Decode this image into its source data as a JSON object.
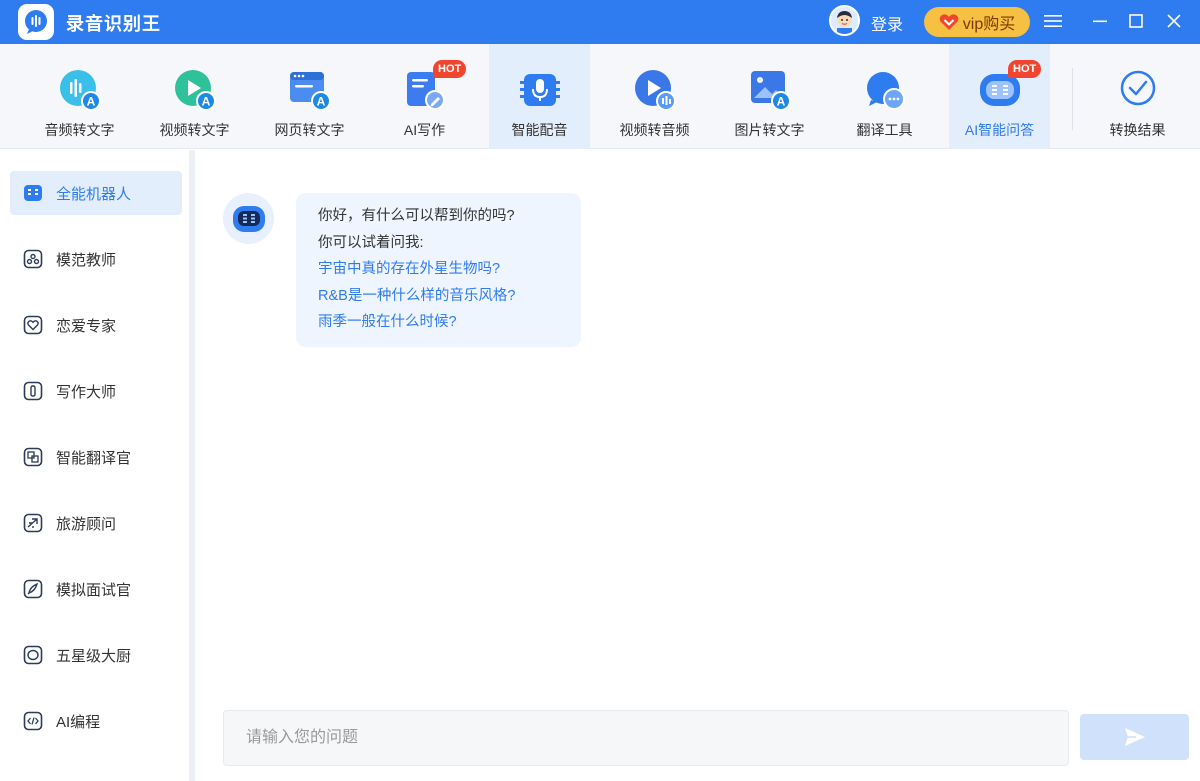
{
  "app": {
    "title": "录音识别王",
    "login_label": "登录",
    "vip_label": "vip购买"
  },
  "colors": {
    "brand": "#2f7bf0",
    "vip": "#f6c042",
    "hot": "#f0462f",
    "active_bg": "#e3eefc"
  },
  "toolbar": {
    "items": [
      {
        "label": "音频转文字",
        "icon": "audio-to-text-icon"
      },
      {
        "label": "视频转文字",
        "icon": "video-to-text-icon"
      },
      {
        "label": "网页转文字",
        "icon": "webpage-to-text-icon"
      },
      {
        "label": "AI写作",
        "icon": "ai-writing-icon",
        "badge": "HOT"
      },
      {
        "label": "智能配音",
        "icon": "smart-dubbing-icon"
      },
      {
        "label": "视频转音频",
        "icon": "video-to-audio-icon"
      },
      {
        "label": "图片转文字",
        "icon": "image-to-text-icon"
      },
      {
        "label": "翻译工具",
        "icon": "translate-icon"
      },
      {
        "label": "AI智能问答",
        "icon": "ai-qa-icon",
        "badge": "HOT"
      }
    ],
    "result_label": "转换结果"
  },
  "sidebar": {
    "items": [
      {
        "label": "全能机器人",
        "icon": "robot-icon"
      },
      {
        "label": "模范教师",
        "icon": "teacher-icon"
      },
      {
        "label": "恋爱专家",
        "icon": "heart-icon"
      },
      {
        "label": "写作大师",
        "icon": "pen-icon"
      },
      {
        "label": "智能翻译官",
        "icon": "translate-icon"
      },
      {
        "label": "旅游顾问",
        "icon": "plane-icon"
      },
      {
        "label": "模拟面试官",
        "icon": "rocket-icon"
      },
      {
        "label": "五星级大厨",
        "icon": "chef-icon"
      },
      {
        "label": "AI编程",
        "icon": "code-icon"
      }
    ]
  },
  "chat": {
    "greeting": "你好，有什么可以帮到你的吗?",
    "hint": "你可以试着问我:",
    "suggestions": [
      "宇宙中真的存在外星生物吗?",
      "R&B是一种什么样的音乐风格?",
      "雨季一般在什么时候?"
    ],
    "input_placeholder": "请输入您的问题"
  }
}
